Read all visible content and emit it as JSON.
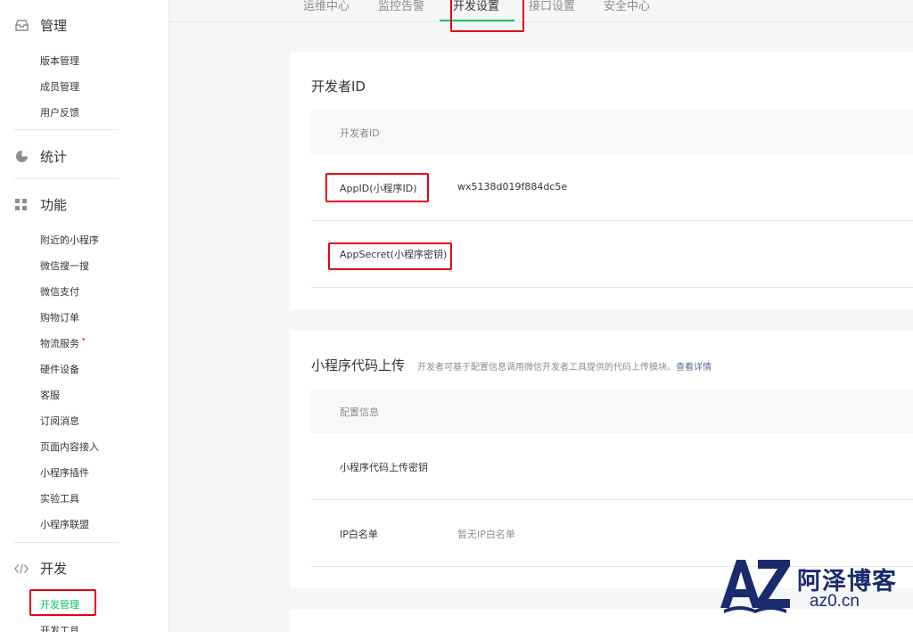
{
  "sidebar": {
    "sections": [
      {
        "icon": "inbox-icon",
        "title": "管理",
        "items": [
          "版本管理",
          "成员管理",
          "用户反馈"
        ]
      },
      {
        "icon": "pie-chart-icon",
        "title": "统计",
        "items": []
      },
      {
        "icon": "grid-icon",
        "title": "功能",
        "items": [
          "附近的小程序",
          "微信搜一搜",
          "微信支付",
          "购物订单",
          "物流服务",
          "硬件设备",
          "客服",
          "订阅消息",
          "页面内容接入",
          "小程序插件",
          "实验工具",
          "小程序联盟"
        ]
      },
      {
        "icon": "code-icon",
        "title": "开发",
        "items": [
          "开发管理",
          "开发工具"
        ]
      }
    ],
    "new_dot": "•"
  },
  "tabs": [
    "运维中心",
    "监控告警",
    "开发设置",
    "接口设置",
    "安全中心"
  ],
  "active_tab": "开发设置",
  "developer_id": {
    "title": "开发者ID",
    "header": "开发者ID",
    "appid_label": "AppID(小程序ID)",
    "appid_value": "wx5138d019f884dc5e",
    "appsecret_label": "AppSecret(小程序密钥)"
  },
  "upload": {
    "title": "小程序代码上传",
    "desc": "开发者可基于配置信息调用微信开发者工具提供的代码上传模块。",
    "link": "查看详情",
    "header": "配置信息",
    "key_label": "小程序代码上传密钥",
    "ip_label": "IP白名单",
    "ip_value": "暂无IP白名单"
  },
  "watermark": {
    "name": "阿泽博客",
    "domain": "az0.cn",
    "logo": "AZ"
  },
  "colors": {
    "accent": "#07c160",
    "highlight": "#e60012",
    "link": "#576b95",
    "watermark": "#1a2b6d"
  }
}
